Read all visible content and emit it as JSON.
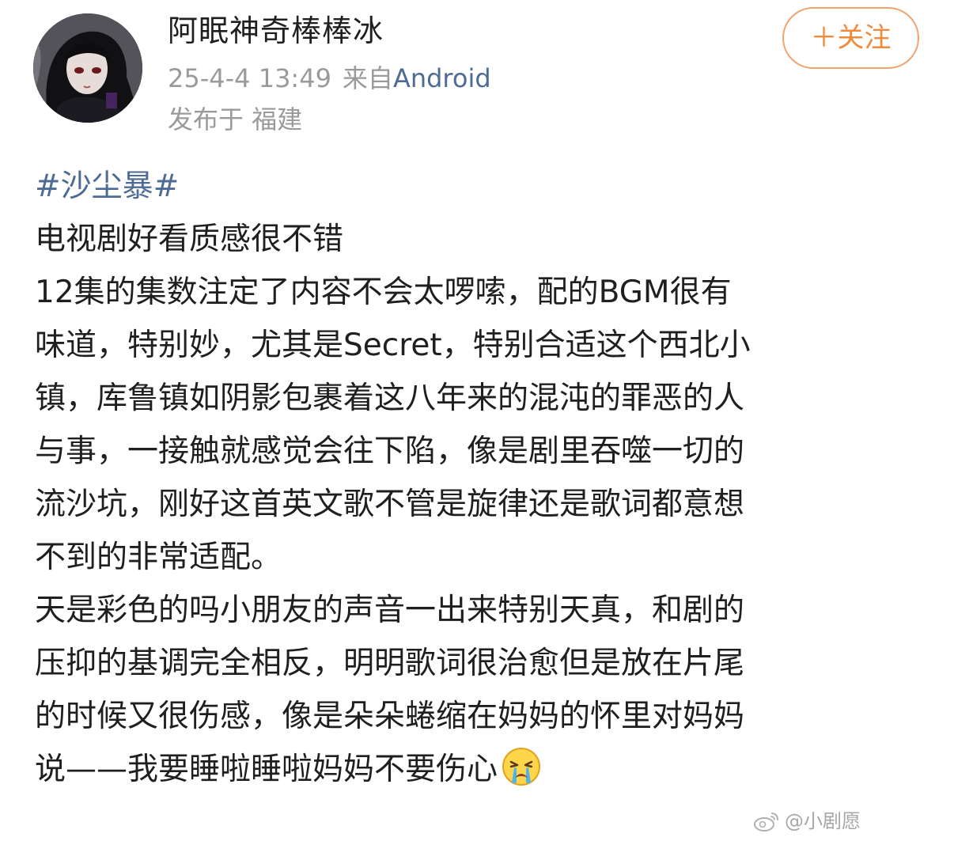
{
  "post": {
    "username": "阿眠神奇棒棒冰",
    "timestamp": "25-4-4 13:49",
    "source_prefix": "来自",
    "source_app": "Android",
    "location": "发布于 福建",
    "follow_label": "＋关注",
    "hashtag": "#沙尘暴#",
    "lines": [
      "电视剧好看质感很不错",
      "12集的集数注定了内容不会太啰嗦，配的BGM很有",
      "味道，特别妙，尤其是Secret，特别合适这个西北小",
      "镇，库鲁镇如阴影包裹着这八年来的混沌的罪恶的人",
      "与事，一接触就感觉会往下陷，像是剧里吞噬一切的",
      "流沙坑，刚好这首英文歌不管是旋律还是歌词都意想",
      "不到的非常适配。",
      "天是彩色的吗小朋友的声音一出来特别天真，和剧的",
      "压抑的基调完全相反，明明歌词很治愈但是放在片尾",
      "的时候又很伤感，像是朵朵蜷缩在妈妈的怀里对妈妈"
    ],
    "last_line": "说——我要睡啦睡啦妈妈不要伤心",
    "last_emoji": "crying-face-icon"
  },
  "watermark": {
    "text": "@小剧愿",
    "icon": "weibo-logo-icon"
  },
  "colors": {
    "link": "#4d6b94",
    "follow": "#f28a3b",
    "meta": "#9a9a9a",
    "text": "#1f1f1f"
  }
}
